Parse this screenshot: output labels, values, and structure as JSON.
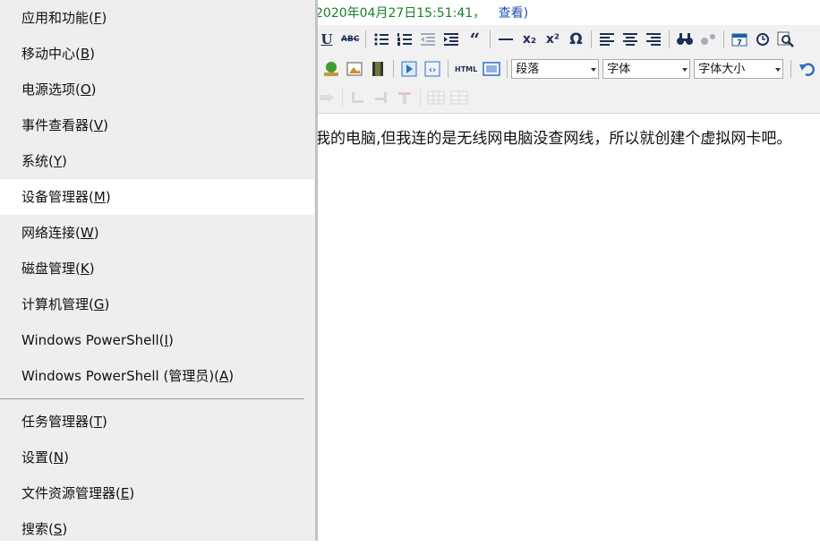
{
  "editor": {
    "status_text": "2020年04月27日15:51:41，",
    "view_link": "查看)",
    "content_text": "我的电脑,但我连的是无线网电脑没查网线，所以就创建个虚拟网卡吧。",
    "toolbar": {
      "row1": [
        {
          "icon": "underline-icon",
          "glyph": "U"
        },
        {
          "icon": "strikethrough-icon",
          "glyph": "ABC"
        },
        {
          "sep": true
        },
        {
          "icon": "bulleted-list-icon"
        },
        {
          "icon": "numbered-list-icon"
        },
        {
          "icon": "outdent-icon"
        },
        {
          "icon": "indent-icon"
        },
        {
          "icon": "blockquote-icon",
          "glyph": "“"
        },
        {
          "sep": true
        },
        {
          "icon": "horizontal-rule-icon"
        },
        {
          "icon": "subscript-icon",
          "glyph": "x₂"
        },
        {
          "icon": "superscript-icon",
          "glyph": "x²"
        },
        {
          "icon": "special-char-icon",
          "glyph": "Ω"
        },
        {
          "sep": true
        },
        {
          "icon": "align-left-icon"
        },
        {
          "icon": "align-center-icon"
        },
        {
          "icon": "align-right-icon"
        },
        {
          "sep": true
        },
        {
          "icon": "find-icon"
        },
        {
          "icon": "replace-icon"
        },
        {
          "sep": true
        },
        {
          "icon": "insert-date-icon"
        },
        {
          "icon": "insert-time-icon"
        },
        {
          "icon": "preview-icon"
        }
      ],
      "row2_icons": [
        "insert-image-tree-icon",
        "insert-picture-icon",
        "insert-video-icon",
        "insert-flash-icon",
        "insert-embed-icon",
        "html-source-icon",
        "fullscreen-icon"
      ],
      "html_label": "HTML",
      "paragraph_select": "段落",
      "font_select": "字体",
      "size_select": "字体大小",
      "undo_icon": "undo-icon",
      "row3_icons": [
        "table-row-icon",
        "table-merge-icon",
        "table-split-icon",
        "table-delete-icon",
        "table-grid-icon",
        "table-props-icon"
      ]
    }
  },
  "menu": {
    "items": [
      {
        "label": "应用和功能(",
        "key": "F",
        "end": ")",
        "selected": false
      },
      {
        "label": "移动中心(",
        "key": "B",
        "end": ")",
        "selected": false
      },
      {
        "label": "电源选项(",
        "key": "O",
        "end": ")",
        "selected": false
      },
      {
        "label": "事件查看器(",
        "key": "V",
        "end": ")",
        "selected": false
      },
      {
        "label": "系统(",
        "key": "Y",
        "end": ")",
        "selected": false
      },
      {
        "label": "设备管理器(",
        "key": "M",
        "end": ")",
        "selected": true
      },
      {
        "label": "网络连接(",
        "key": "W",
        "end": ")",
        "selected": false
      },
      {
        "label": "磁盘管理(",
        "key": "K",
        "end": ")",
        "selected": false
      },
      {
        "label": "计算机管理(",
        "key": "G",
        "end": ")",
        "selected": false
      },
      {
        "label": "Windows PowerShell(",
        "key": "I",
        "end": ")",
        "selected": false
      },
      {
        "label": "Windows PowerShell (管理员)(",
        "key": "A",
        "end": ")",
        "selected": false
      },
      {
        "label": "任务管理器(",
        "key": "T",
        "end": ")",
        "selected": false
      },
      {
        "label": "设置(",
        "key": "N",
        "end": ")",
        "selected": false
      },
      {
        "label": "文件资源管理器(",
        "key": "E",
        "end": ")",
        "selected": false
      },
      {
        "label": "搜索(",
        "key": "S",
        "end": ")",
        "selected": false
      }
    ]
  }
}
